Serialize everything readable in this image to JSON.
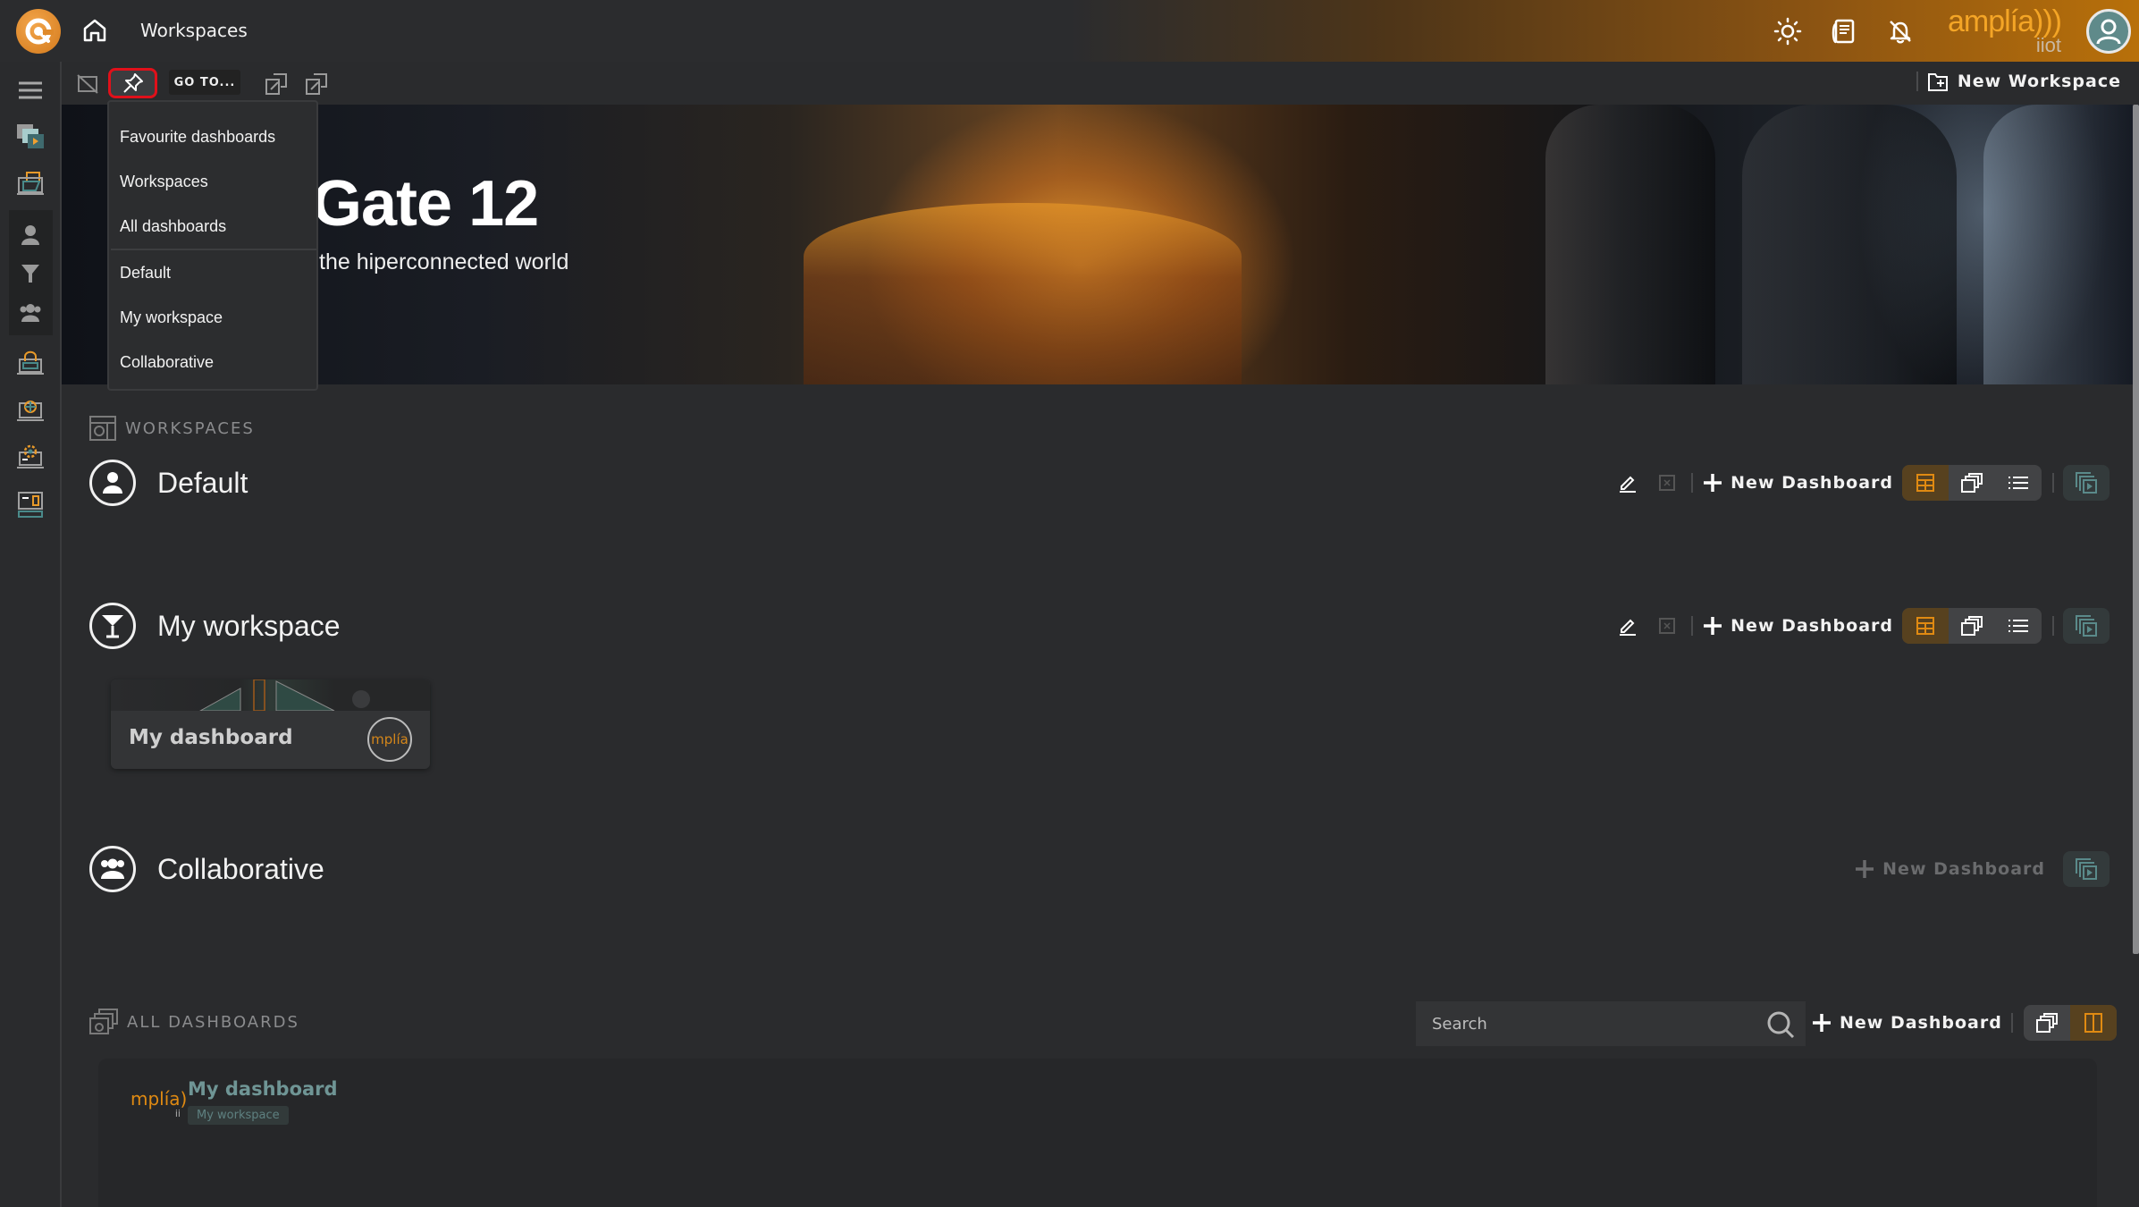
{
  "header": {
    "title": "Workspaces",
    "icons": [
      "logo-icon",
      "home-icon",
      "theme-sun-icon",
      "documentation-icon",
      "notifications-off-icon"
    ],
    "brand_main": "amplía)))",
    "brand_sub": "iiot"
  },
  "toolbar": {
    "goto_label": "GO TO...",
    "new_workspace_label": "New Workspace"
  },
  "goto_menu": {
    "items": [
      {
        "label": "Favourite dashboards"
      },
      {
        "label": "Workspaces"
      },
      {
        "label": "All dashboards"
      }
    ],
    "workspaces": [
      {
        "label": "Default"
      },
      {
        "label": "My workspace"
      },
      {
        "label": "Collaborative"
      }
    ]
  },
  "hero": {
    "title": "Gate 12",
    "subtitle": "the hiperconnected world"
  },
  "sidebar": {
    "items": [
      {
        "icon": "menu-icon"
      },
      {
        "icon": "presentations-icon"
      },
      {
        "icon": "dashboards-folder-icon"
      },
      {
        "icon": "user-icon"
      },
      {
        "icon": "filter-icon"
      },
      {
        "icon": "group-icon"
      },
      {
        "icon": "security-icon"
      },
      {
        "icon": "monitoring-icon"
      },
      {
        "icon": "settings-icon"
      },
      {
        "icon": "device-icon"
      }
    ]
  },
  "workspaces_section": {
    "label": "WORKSPACES",
    "workspaces": [
      {
        "name": "Default",
        "icon": "user-icon",
        "new_dashboard_label": "New Dashboard",
        "new_dashboard_enabled": true
      },
      {
        "name": "My workspace",
        "icon": "cocktail-icon",
        "new_dashboard_label": "New Dashboard",
        "new_dashboard_enabled": true,
        "dashboards": [
          {
            "title": "My dashboard",
            "logo_text": "mplía"
          }
        ]
      },
      {
        "name": "Collaborative",
        "icon": "group-icon",
        "new_dashboard_label": "New Dashboard",
        "new_dashboard_enabled": false
      }
    ]
  },
  "all_dashboards_section": {
    "label": "ALL DASHBOARDS",
    "search_placeholder": "Search",
    "new_dashboard_label": "New Dashboard",
    "items": [
      {
        "title": "My dashboard",
        "workspace": "My workspace",
        "logo_text": "mplía)",
        "logo_sub": "ii"
      }
    ]
  },
  "colors": {
    "accent": "#e08a12",
    "brand_orange": "#f4a526",
    "teal": "#6f9595",
    "highlight_red": "#e0101a"
  }
}
